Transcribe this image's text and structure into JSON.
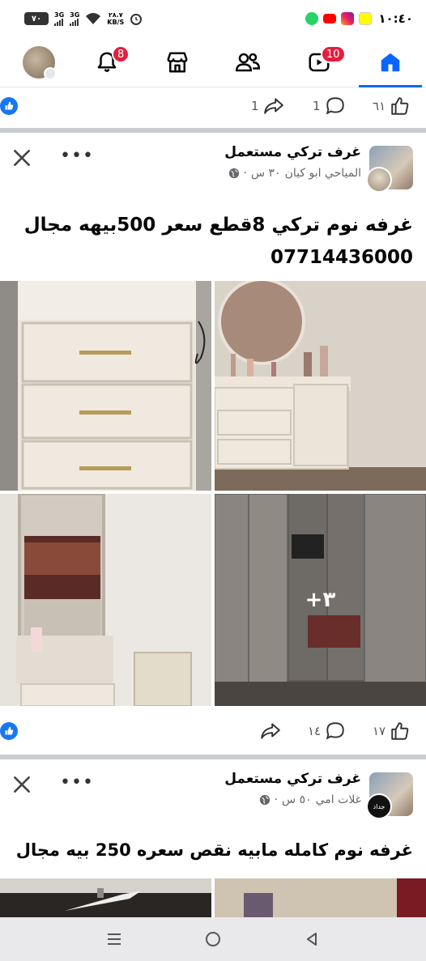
{
  "status_bar": {
    "battery": "٧٠",
    "sim1": "3G",
    "sim2": "3G",
    "speed_value": "٢٨.٧",
    "speed_unit": "KB/S",
    "time": "١٠:٤٠",
    "apps": [
      "whatsapp-icon",
      "youtube-icon",
      "instagram-icon",
      "snapchat-icon"
    ]
  },
  "nav": {
    "notifications_badge": "8",
    "video_badge": "10",
    "accent": "#0866ff",
    "badge_color": "#e41e3f"
  },
  "prev_post_actions": {
    "likes": "٦١",
    "comments": "1",
    "shares": "1"
  },
  "posts": [
    {
      "group": "غرف تركي مستعمل",
      "author": "المياحي ابو كيان",
      "time": "٣٠ س",
      "text_line1": "غرفه نوم تركي 8قطع سعر 500بيهه مجال",
      "text_line2": "07714436000",
      "more_photos": "+٣",
      "likes": "١٧",
      "comments": "١٤"
    },
    {
      "group": "غرف تركي مستعمل",
      "author": "غلات امي",
      "time": "٥٠ س",
      "avatar_text": "جداد",
      "text_line1": "غرفه نوم كامله مابيه نقص سعره 250 بيه مجال"
    }
  ]
}
